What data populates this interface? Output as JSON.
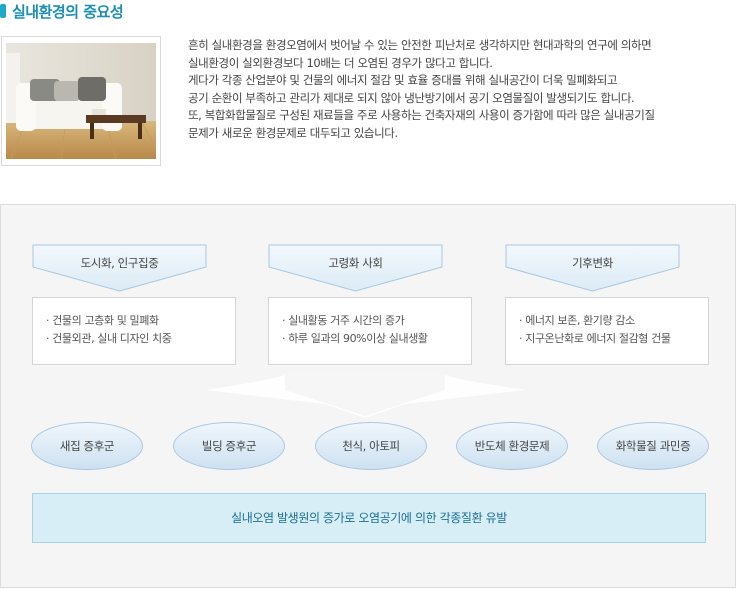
{
  "page": {
    "title": "실내환경의 중요성"
  },
  "intro": {
    "lines": [
      "흔히 실내환경을 환경오염에서 벗어날 수 있는 안전한 피난처로 생각하지만 현대과학의 연구에 의하면",
      "실내환경이 실외환경보다 10배는 더 오염된 경우가 많다고 합니다.",
      "게다가 각종 산업분야 및 건물의 에너지 절감 및 효율 증대를 위해 실내공간이 더욱 밀폐화되고",
      "공기 순환이 부족하고 관리가 제대로 되지 않아 냉난방기에서 공기 오염물질이 발생되기도 합니다.",
      "또, 복합화합물질로 구성된 재료들을 주로 사용하는 건축자재의 사용이 증가함에 따라 많은 실내공기질",
      "문제가 새로운 환경문제로 대두되고 있습니다."
    ]
  },
  "categories": [
    {
      "label": "도시화, 인구집중",
      "items": [
        "· 건물의 고층화 및 밀폐화",
        "· 건물외관, 실내 디자인 치중"
      ]
    },
    {
      "label": "고령화 사회",
      "items": [
        "· 실내활동 거주 시간의 증가",
        "· 하루 일과의 90%이상 실내생활"
      ]
    },
    {
      "label": "기후변화",
      "items": [
        "· 에너지 보존, 환기량 감소",
        "· 지구온난화로 에너지 절감형 건물"
      ]
    }
  ],
  "effects": [
    "새집 증후군",
    "빌딩 증후군",
    "천식, 아토피",
    "반도체 환경문제",
    "화학물질 과민증"
  ],
  "result": "실내오염 발생원의 증가로 오염공기에 의한 각종질환 유발",
  "colors": {
    "accent": "#1fa8c9",
    "title": "#1b8fb5",
    "pill_border": "#a9c7e0",
    "result_bg": "#d8eef7",
    "result_text": "#1a6f95"
  }
}
